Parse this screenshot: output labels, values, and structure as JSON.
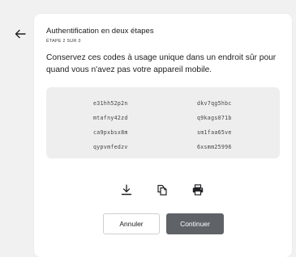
{
  "header": {
    "title": "Authentification en deux étapes",
    "step": "ÉTAPE 2 SUR 3"
  },
  "description": "Conservez ces codes à usage unique dans un endroit sûr pour quand vous n'avez pas votre appareil mobile.",
  "codes": [
    "e31hh52p2n",
    "dkv7qg5hbc",
    "mtafny42zd",
    "q9kags071b",
    "ca9pxbsx8m",
    "sm1faa65ve",
    "qypvmfedzv",
    "6xsmm25996"
  ],
  "actions": {
    "download_icon": "download-icon",
    "copy_icon": "copy-icon",
    "print_icon": "print-icon"
  },
  "buttons": {
    "cancel": "Annuler",
    "continue": "Continuer"
  },
  "colors": {
    "background": "#f1f1f1",
    "card": "#ffffff",
    "codes_bg": "#eeeeee",
    "primary_button": "#5f6368"
  }
}
